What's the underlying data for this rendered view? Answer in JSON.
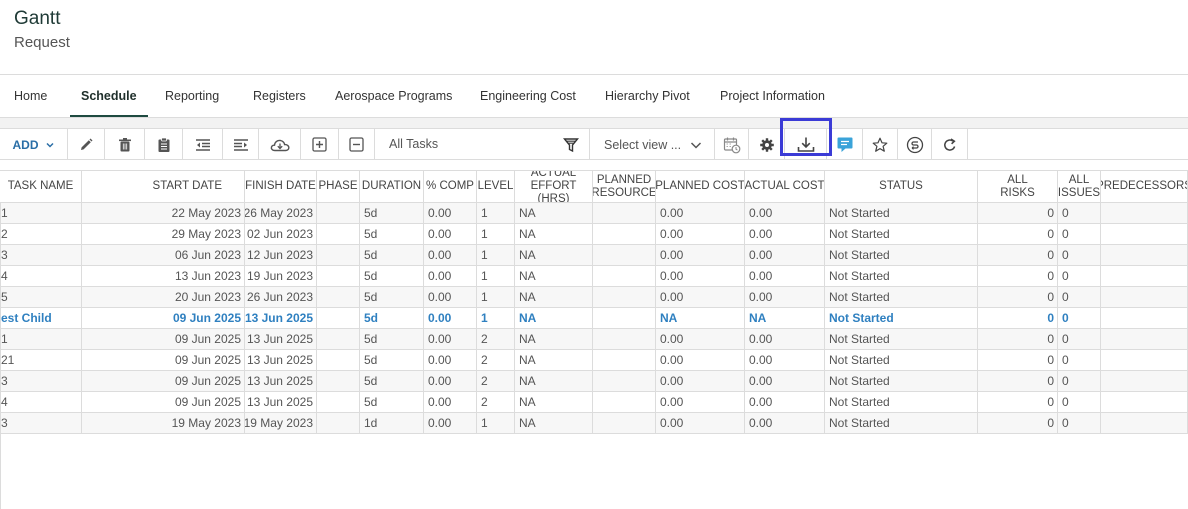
{
  "header": {
    "title": "Gantt",
    "subtitle": "Request"
  },
  "tabs": [
    {
      "label": "Home",
      "active": false
    },
    {
      "label": "Schedule",
      "active": true
    },
    {
      "label": "Reporting",
      "active": false
    },
    {
      "label": "Registers",
      "active": false
    },
    {
      "label": "Aerospace Programs",
      "active": false
    },
    {
      "label": "Engineering Cost",
      "active": false
    },
    {
      "label": "Hierarchy Pivot",
      "active": false
    },
    {
      "label": "Project Information",
      "active": false
    }
  ],
  "toolbar": {
    "add_label": "ADD",
    "view_filter": "All Tasks",
    "select_view": "Select view ...",
    "icons": [
      "edit-icon",
      "delete-icon",
      "clipboard-icon",
      "outdent-icon",
      "indent-icon",
      "cloud-icon",
      "expand-icon",
      "collapse-icon",
      "filter-icon",
      "calendar-icon",
      "settings-icon",
      "download-icon",
      "comment-icon",
      "star-icon",
      "sync-icon",
      "refresh-icon"
    ],
    "accent": "#2a6ea6",
    "highlight_color": "#3b3bd6"
  },
  "grid": {
    "columns": [
      "TASK NAME",
      "START DATE",
      "FINISH DATE",
      "PHASE",
      "DURATION",
      "% COMP",
      "LEVEL",
      "ACTUAL EFFORT (HRS)",
      "PLANNED RESOURCE",
      "PLANNED COST",
      "ACTUAL COST",
      "STATUS",
      "ALL RISKS",
      "ALL ISSUES",
      "PREDECESSORS"
    ],
    "rows": [
      {
        "task": "1",
        "start": "22 May 2023",
        "finish": "26 May 2023",
        "phase": "",
        "duration": "5d",
        "comp": "0.00",
        "level": "1",
        "effort": "NA",
        "resource": "",
        "pcost": "0.00",
        "acost": "0.00",
        "status": "Not Started",
        "risks": "0",
        "issues": "0",
        "pred": "",
        "bold": false
      },
      {
        "task": "2",
        "start": "29 May 2023",
        "finish": "02 Jun 2023",
        "phase": "",
        "duration": "5d",
        "comp": "0.00",
        "level": "1",
        "effort": "NA",
        "resource": "",
        "pcost": "0.00",
        "acost": "0.00",
        "status": "Not Started",
        "risks": "0",
        "issues": "0",
        "pred": "",
        "bold": false
      },
      {
        "task": "3",
        "start": "06 Jun 2023",
        "finish": "12 Jun 2023",
        "phase": "",
        "duration": "5d",
        "comp": "0.00",
        "level": "1",
        "effort": "NA",
        "resource": "",
        "pcost": "0.00",
        "acost": "0.00",
        "status": "Not Started",
        "risks": "0",
        "issues": "0",
        "pred": "",
        "bold": false
      },
      {
        "task": "4",
        "start": "13 Jun 2023",
        "finish": "19 Jun 2023",
        "phase": "",
        "duration": "5d",
        "comp": "0.00",
        "level": "1",
        "effort": "NA",
        "resource": "",
        "pcost": "0.00",
        "acost": "0.00",
        "status": "Not Started",
        "risks": "0",
        "issues": "0",
        "pred": "",
        "bold": false
      },
      {
        "task": "5",
        "start": "20 Jun 2023",
        "finish": "26 Jun 2023",
        "phase": "",
        "duration": "5d",
        "comp": "0.00",
        "level": "1",
        "effort": "NA",
        "resource": "",
        "pcost": "0.00",
        "acost": "0.00",
        "status": "Not Started",
        "risks": "0",
        "issues": "0",
        "pred": "",
        "bold": false
      },
      {
        "task": "est Child",
        "start": "09 Jun 2025",
        "finish": "13 Jun 2025",
        "phase": "",
        "duration": "5d",
        "comp": "0.00",
        "level": "1",
        "effort": "NA",
        "resource": "",
        "pcost": "NA",
        "acost": "NA",
        "status": "Not Started",
        "risks": "0",
        "issues": "0",
        "pred": "",
        "bold": true
      },
      {
        "task": "1",
        "start": "09 Jun 2025",
        "finish": "13 Jun 2025",
        "phase": "",
        "duration": "5d",
        "comp": "0.00",
        "level": "2",
        "effort": "NA",
        "resource": "",
        "pcost": "0.00",
        "acost": "0.00",
        "status": "Not Started",
        "risks": "0",
        "issues": "0",
        "pred": "",
        "bold": false
      },
      {
        "task": "21",
        "start": "09 Jun 2025",
        "finish": "13 Jun 2025",
        "phase": "",
        "duration": "5d",
        "comp": "0.00",
        "level": "2",
        "effort": "NA",
        "resource": "",
        "pcost": "0.00",
        "acost": "0.00",
        "status": "Not Started",
        "risks": "0",
        "issues": "0",
        "pred": "",
        "bold": false
      },
      {
        "task": "3",
        "start": "09 Jun 2025",
        "finish": "13 Jun 2025",
        "phase": "",
        "duration": "5d",
        "comp": "0.00",
        "level": "2",
        "effort": "NA",
        "resource": "",
        "pcost": "0.00",
        "acost": "0.00",
        "status": "Not Started",
        "risks": "0",
        "issues": "0",
        "pred": "",
        "bold": false
      },
      {
        "task": "4",
        "start": "09 Jun 2025",
        "finish": "13 Jun 2025",
        "phase": "",
        "duration": "5d",
        "comp": "0.00",
        "level": "2",
        "effort": "NA",
        "resource": "",
        "pcost": "0.00",
        "acost": "0.00",
        "status": "Not Started",
        "risks": "0",
        "issues": "0",
        "pred": "",
        "bold": false
      },
      {
        "task": "3",
        "start": "19 May 2023",
        "finish": "19 May 2023",
        "phase": "",
        "duration": "1d",
        "comp": "0.00",
        "level": "1",
        "effort": "NA",
        "resource": "",
        "pcost": "0.00",
        "acost": "0.00",
        "status": "Not Started",
        "risks": "0",
        "issues": "0",
        "pred": "",
        "bold": false
      }
    ]
  }
}
